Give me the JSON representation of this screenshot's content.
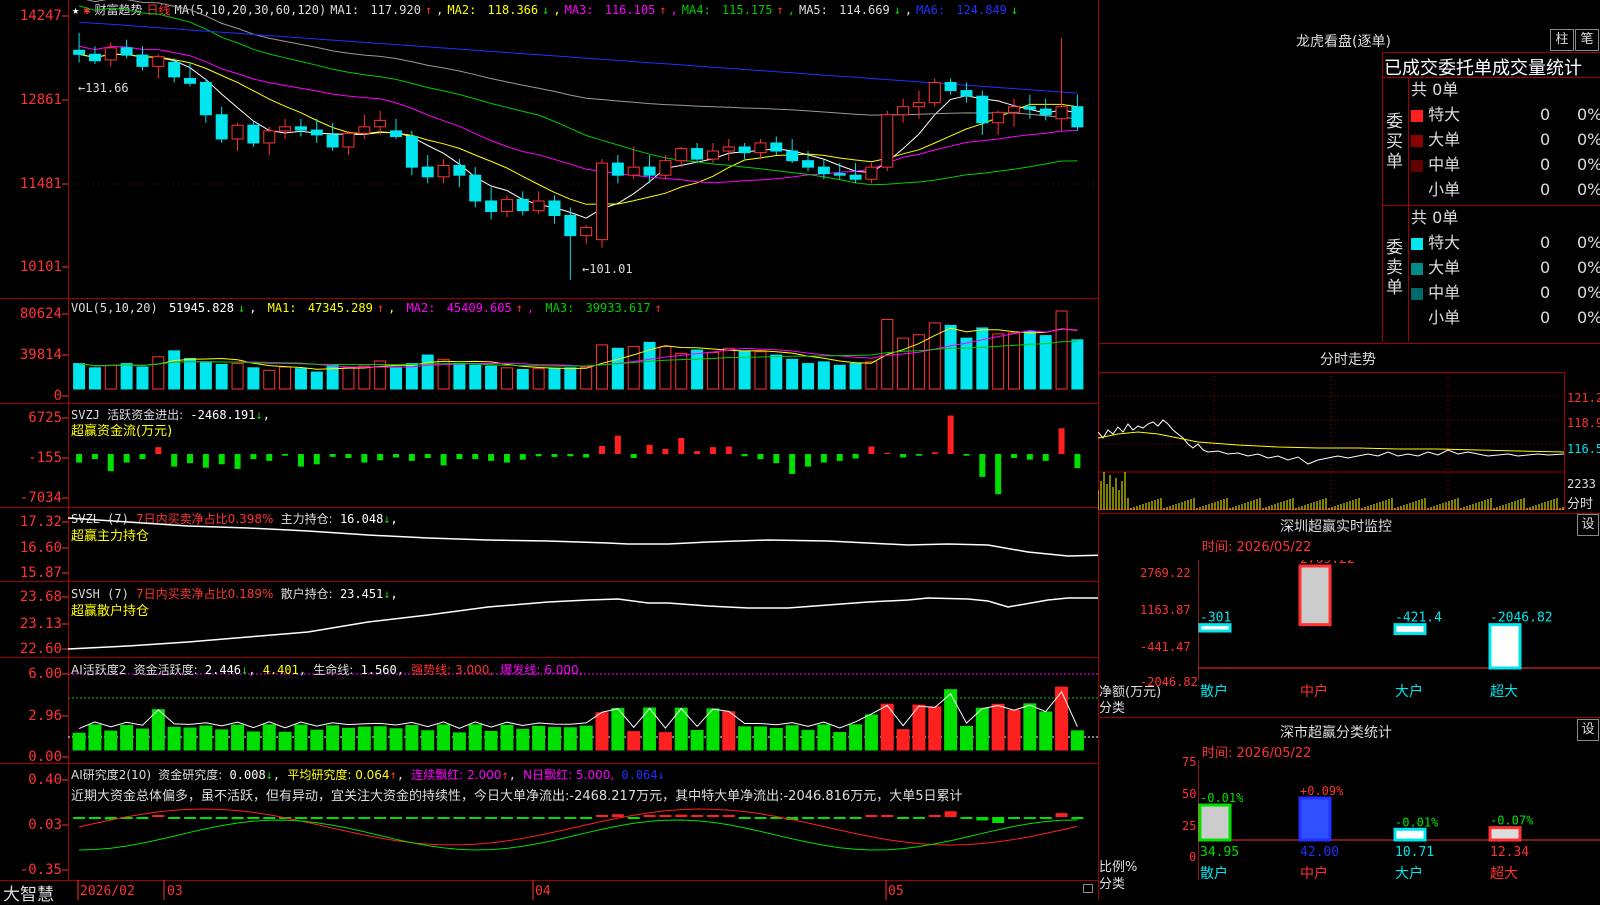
{
  "colors": {
    "up": "#ff3232",
    "down": "#00e5ee",
    "ma1": "#ffffff",
    "ma2": "#ffff00",
    "ma3": "#ff00ff",
    "ma4": "#00cc00",
    "ma5": "#9a9a9a",
    "ma6": "#2030ff",
    "green": "#00e000",
    "frame": "#a00000"
  },
  "main_chart": {
    "header": {
      "star": "★",
      "flag": "✱",
      "title": "财富趋势",
      "period": "日线",
      "ma_params": "MA(5,10,20,30,60,120)",
      "ma": [
        {
          "label": "MA1:",
          "value": "117.920",
          "arrow": "↑"
        },
        {
          "label": "MA2:",
          "value": "118.366",
          "arrow": "↓"
        },
        {
          "label": "MA3:",
          "value": "116.105",
          "arrow": "↑"
        },
        {
          "label": "MA4:",
          "value": "115.175",
          "arrow": "↑"
        },
        {
          "label": "MA5:",
          "value": "114.669",
          "arrow": "↓"
        },
        {
          "label": "MA6:",
          "value": "124.849",
          "arrow": "↓"
        }
      ]
    },
    "y_ticks": [
      "14247",
      "12861",
      "11481",
      "10101"
    ],
    "high_marker": "←131.66",
    "low_marker": "←101.01"
  },
  "vol_panel": {
    "name": "VOL(5,10,20)",
    "value": "51945.828",
    "arrow": "↓",
    "ma": [
      {
        "label": "MA1:",
        "value": "47345.289",
        "arrow": "↑"
      },
      {
        "label": "MA2:",
        "value": "45409.605",
        "arrow": "↑"
      },
      {
        "label": "MA3:",
        "value": "39933.617",
        "arrow": "↑"
      }
    ],
    "y_ticks": [
      "80624",
      "39814",
      "0"
    ]
  },
  "svzj_panel": {
    "name": "SVZJ",
    "label": "活跃资金进出:",
    "value": "-2468.191",
    "arrow": "↓",
    "sub": "超赢资金流(万元)",
    "y_ticks": [
      "6725",
      "-155",
      "-7034"
    ]
  },
  "svzl_panel": {
    "name": "SVZL (7)",
    "label": "7日内买卖净占比0.398%",
    "label2": "主力持仓:",
    "value": "16.048",
    "arrow": "↓",
    "sub": "超赢主力持仓",
    "y_ticks": [
      "17.32",
      "16.60",
      "15.87"
    ]
  },
  "svsh_panel": {
    "name": "SVSH (7)",
    "label": "7日内买卖净占比0.189%",
    "label2": "散户持仓:",
    "value": "23.451",
    "arrow": "↓",
    "sub": "超赢散户持仓",
    "y_ticks": [
      "23.68",
      "23.13",
      "22.60"
    ]
  },
  "ai_active": {
    "name": "AI活跃度2",
    "label": "资金活跃度:",
    "value": "2.446",
    "value2": "4.401",
    "life_label": "生命线:",
    "life": "1.560",
    "strong": "强势线: 3.000,",
    "burst": "爆发线: 6.000,",
    "y_ticks": [
      "6.00",
      "2.96",
      "0.00"
    ]
  },
  "ai_research": {
    "name": "AI研究度2(10)",
    "label": "资金研究度:",
    "value": "0.008",
    "avg": "平均研究度: 0.064",
    "cont": "连续飘红: 2.000",
    "nday": "N日飘红: 5.000,",
    "last": "0.064",
    "comment": "近期大资金总体偏多，虽不活跃，但有异动，宜关注大资金的持续性，今日大单净流出:-2468.217万元，其中特大单净流出:-2046.816万元，大单5日累计",
    "y_ticks": [
      "0.40",
      "0.03",
      "-0.35"
    ]
  },
  "bottom_axis": {
    "brand": "大智慧",
    "labels": [
      "2026/02",
      "03",
      "04",
      "05"
    ]
  },
  "right": {
    "title": "龙虎看盘(逐单)",
    "btn1": "柱",
    "btn2": "笔",
    "table_title": "已成交委托单成交量统计",
    "buy_label": "委买单",
    "sell_label": "委卖单",
    "buy_total": "共 0单",
    "sell_total": "共 0单",
    "rows": [
      {
        "name": "特大",
        "count": "0",
        "pct": "0%"
      },
      {
        "name": "大单",
        "count": "0",
        "pct": "0%"
      },
      {
        "name": "中单",
        "count": "0",
        "pct": "0%"
      },
      {
        "name": "小单",
        "count": "0",
        "pct": "0%"
      }
    ],
    "sell_rows": [
      {
        "name": "特大",
        "count": "0",
        "pct": "0%"
      },
      {
        "name": "大单",
        "count": "0",
        "pct": "0%"
      },
      {
        "name": "中单",
        "count": "0",
        "pct": "0%"
      },
      {
        "name": "小单",
        "count": "0",
        "pct": "0%"
      }
    ],
    "intraday_title": "分时走势",
    "intraday_ticks": [
      "121.2",
      "118.9",
      "116.5",
      "2233",
      "分时"
    ],
    "monitor_title": "深圳超赢实时监控",
    "monitor_btn": "设",
    "monitor_date": "时间: 2026/05/22",
    "monitor_yticks": [
      "2769.22",
      "1163.87",
      "-441.47",
      "-2046.82"
    ],
    "monitor_bars": [
      {
        "cat": "散户",
        "value": "-301"
      },
      {
        "cat": "中户",
        "value": "2769.22"
      },
      {
        "cat": "大户",
        "value": "-421.4"
      },
      {
        "cat": "超大",
        "value": "-2046.82"
      }
    ],
    "monitor_ylab1": "净额(万元)",
    "monitor_ylab2": "分类",
    "stats_title": "深市超赢分类统计",
    "stats_btn": "设",
    "stats_date": "时间: 2026/05/22",
    "stats_yticks": [
      "75",
      "50",
      "25",
      "0"
    ],
    "stats_bars": [
      {
        "cat": "散户",
        "value": "34.95",
        "delta": "-0.01%"
      },
      {
        "cat": "中户",
        "value": "42.00",
        "delta": "+0.09%"
      },
      {
        "cat": "大户",
        "value": "10.71",
        "delta": "-0.01%"
      },
      {
        "cat": "超大",
        "value": "12.34",
        "delta": "-0.07%"
      }
    ],
    "stats_ylab1": "比例%",
    "stats_ylab2": "分类"
  },
  "chart_data": {
    "type": "candlestick",
    "price_range": [
      100.5,
      134
    ],
    "candles": [
      [
        129.5,
        131.66,
        128.0,
        129.0
      ],
      [
        129.0,
        130.0,
        127.8,
        128.2
      ],
      [
        128.3,
        130.5,
        127.5,
        129.8
      ],
      [
        129.8,
        130.8,
        128.5,
        128.9
      ],
      [
        128.9,
        130.0,
        127.0,
        127.5
      ],
      [
        127.5,
        129.0,
        126.0,
        128.7
      ],
      [
        128.0,
        128.5,
        125.5,
        126.2
      ],
      [
        126.0,
        128.0,
        125.0,
        125.4
      ],
      [
        125.5,
        126.0,
        120.5,
        121.5
      ],
      [
        121.5,
        122.5,
        118.0,
        118.5
      ],
      [
        118.5,
        120.5,
        117.0,
        120.2
      ],
      [
        120.2,
        120.8,
        117.5,
        118.0
      ],
      [
        118.0,
        120.0,
        116.5,
        119.5
      ],
      [
        119.5,
        121.0,
        118.5,
        120.0
      ],
      [
        120.0,
        121.0,
        118.8,
        119.6
      ],
      [
        119.6,
        121.0,
        118.0,
        119.0
      ],
      [
        119.0,
        120.5,
        117.0,
        117.5
      ],
      [
        117.5,
        119.5,
        116.5,
        119.2
      ],
      [
        119.2,
        121.5,
        118.5,
        120.0
      ],
      [
        120.0,
        122.0,
        119.0,
        120.8
      ],
      [
        119.5,
        121.0,
        118.5,
        118.8
      ],
      [
        118.8,
        119.5,
        114.0,
        115.0
      ],
      [
        115.0,
        116.5,
        113.0,
        113.8
      ],
      [
        113.8,
        116.0,
        113.0,
        115.2
      ],
      [
        115.2,
        116.0,
        112.5,
        114.0
      ],
      [
        114.0,
        115.0,
        110.0,
        110.8
      ],
      [
        110.8,
        112.5,
        108.5,
        109.5
      ],
      [
        109.5,
        111.5,
        108.8,
        111.0
      ],
      [
        111.0,
        112.0,
        109.0,
        109.6
      ],
      [
        109.6,
        112.0,
        109.2,
        110.8
      ],
      [
        110.8,
        111.5,
        108.0,
        109.0
      ],
      [
        109.0,
        110.0,
        101.01,
        106.5
      ],
      [
        106.5,
        107.8,
        105.5,
        107.5
      ],
      [
        106.0,
        116.0,
        105.0,
        115.5
      ],
      [
        115.5,
        116.5,
        113.0,
        114.0
      ],
      [
        114.0,
        117.5,
        113.5,
        115.0
      ],
      [
        115.0,
        116.5,
        113.0,
        114.0
      ],
      [
        114.0,
        116.5,
        113.5,
        115.8
      ],
      [
        115.8,
        117.5,
        115.0,
        117.3
      ],
      [
        117.3,
        118.0,
        115.5,
        116.0
      ],
      [
        116.0,
        118.0,
        115.5,
        117.0
      ],
      [
        117.0,
        118.5,
        115.8,
        117.5
      ],
      [
        117.5,
        118.0,
        116.0,
        116.8
      ],
      [
        116.8,
        118.5,
        116.0,
        118.0
      ],
      [
        118.0,
        118.8,
        116.5,
        117.0
      ],
      [
        117.0,
        118.5,
        115.5,
        115.8
      ],
      [
        115.8,
        117.0,
        114.5,
        115.0
      ],
      [
        115.0,
        116.0,
        113.5,
        114.2
      ],
      [
        114.2,
        115.5,
        113.5,
        114.0
      ],
      [
        114.0,
        115.5,
        113.0,
        113.5
      ],
      [
        113.5,
        115.5,
        113.0,
        115.0
      ],
      [
        115.0,
        122.0,
        114.5,
        121.5
      ],
      [
        121.5,
        123.5,
        120.5,
        122.5
      ],
      [
        122.5,
        124.5,
        121.0,
        123.0
      ],
      [
        123.0,
        126.0,
        122.5,
        125.5
      ],
      [
        125.5,
        126.0,
        124.0,
        124.5
      ],
      [
        124.5,
        125.5,
        123.0,
        123.8
      ],
      [
        123.8,
        124.5,
        119.0,
        120.5
      ],
      [
        120.5,
        122.0,
        119.0,
        121.8
      ],
      [
        121.8,
        123.5,
        120.0,
        122.5
      ],
      [
        122.5,
        124.0,
        121.0,
        122.2
      ],
      [
        122.2,
        123.5,
        120.8,
        121.5
      ],
      [
        121.0,
        131.0,
        119.5,
        122.5
      ],
      [
        122.5,
        124.0,
        119.5,
        120.0
      ]
    ],
    "volume": [
      30000,
      25000,
      28000,
      30000,
      26000,
      38000,
      45000,
      36000,
      32000,
      29000,
      30000,
      25000,
      22000,
      26000,
      24000,
      20000,
      28000,
      25000,
      27000,
      33000,
      26000,
      30000,
      40000,
      35000,
      30000,
      28000,
      27000,
      25000,
      23000,
      24000,
      24000,
      25000,
      26000,
      52000,
      48000,
      50000,
      55000,
      50000,
      42000,
      46000,
      43000,
      48000,
      45000,
      44000,
      40000,
      35000,
      30000,
      32000,
      28000,
      30000,
      32000,
      82000,
      60000,
      64000,
      78000,
      75000,
      60000,
      72000,
      65000,
      66000,
      68000,
      63000,
      92000,
      58000
    ],
    "fund_flow": [
      -1500,
      -900,
      -3000,
      -1500,
      -900,
      1200,
      -2200,
      -1600,
      -2400,
      -1800,
      -2600,
      -900,
      -1200,
      -300,
      -2200,
      -1800,
      -500,
      -700,
      -1500,
      -1100,
      -600,
      -1200,
      -700,
      -2000,
      -900,
      -900,
      -1200,
      -1500,
      -1000,
      -400,
      -500,
      -400,
      -600,
      1400,
      3200,
      -700,
      1600,
      900,
      2800,
      500,
      1200,
      1300,
      -400,
      -900,
      -1600,
      -3500,
      -2200,
      -1500,
      -1200,
      -800,
      1300,
      200,
      -600,
      -300,
      300,
      6725,
      -300,
      -4000,
      -7034,
      -700,
      -1000,
      -1200,
      4500,
      -2468
    ],
    "ma_lines": [
      "MA1",
      "MA2",
      "MA3",
      "MA4",
      "MA5",
      "MA6"
    ]
  }
}
